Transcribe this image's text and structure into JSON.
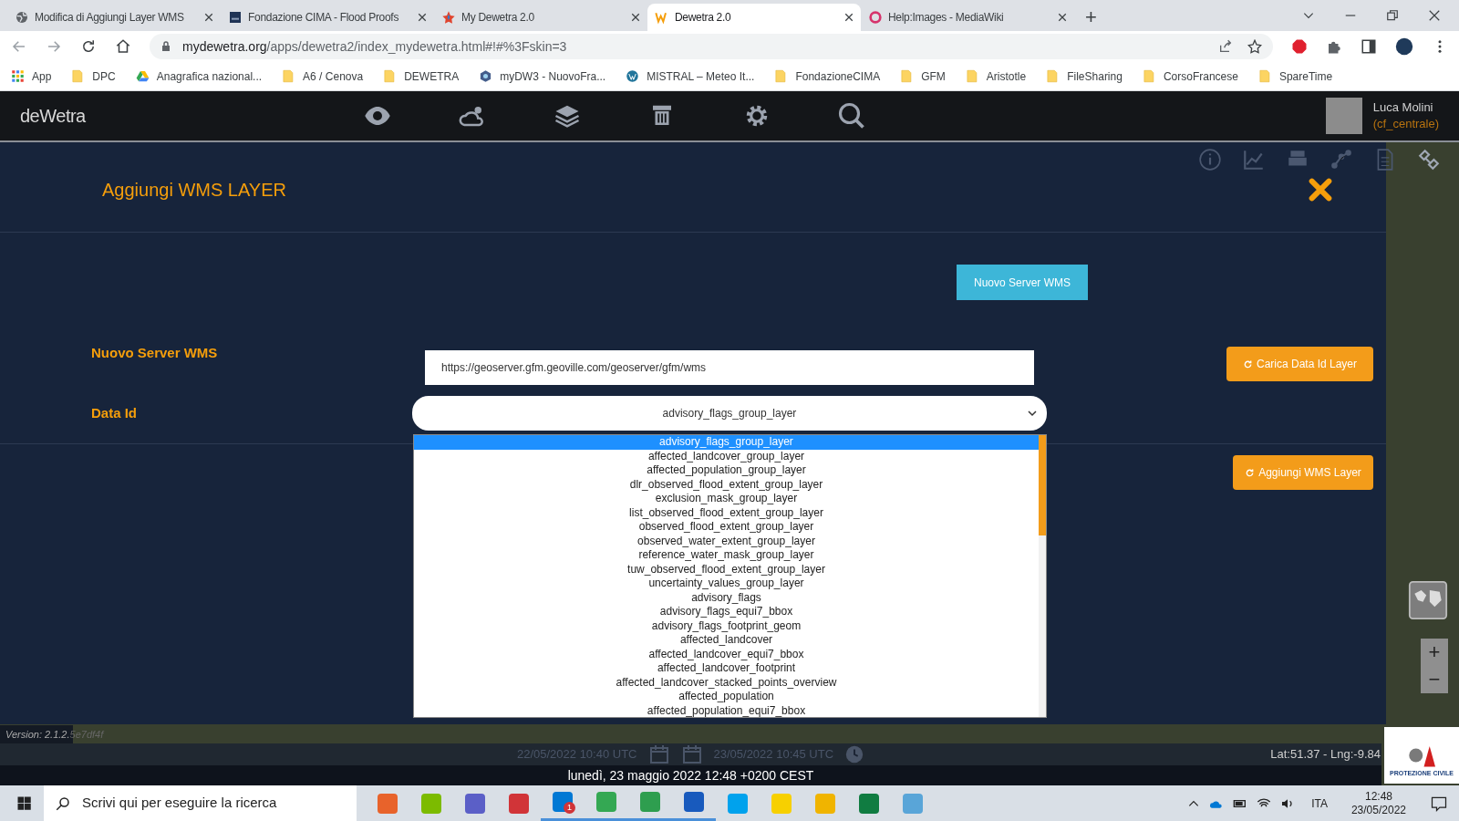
{
  "browser": {
    "tabs": [
      {
        "title": "Modifica di Aggiungi Layer WMS",
        "selected": false
      },
      {
        "title": "Fondazione CIMA - Flood Proofs",
        "selected": false
      },
      {
        "title": "My Dewetra 2.0",
        "selected": false
      },
      {
        "title": "Dewetra 2.0",
        "selected": true
      },
      {
        "title": "Help:Images - MediaWiki",
        "selected": false
      }
    ],
    "new_tab": "+",
    "url_host": "mydewetra.org",
    "url_path": "/apps/dewetra2/index_mydewetra.html#!#%3Fskin=3",
    "bookmarks": [
      {
        "label": "App",
        "kind": "apps"
      },
      {
        "label": "DPC",
        "kind": "folder"
      },
      {
        "label": "Anagrafica nazional...",
        "kind": "drive"
      },
      {
        "label": "A6 / Cenova",
        "kind": "folder"
      },
      {
        "label": "DEWETRA",
        "kind": "folder"
      },
      {
        "label": "myDW3 - NuovoFra...",
        "kind": "site"
      },
      {
        "label": "MISTRAL – Meteo It...",
        "kind": "wp"
      },
      {
        "label": "FondazioneCIMA",
        "kind": "folder"
      },
      {
        "label": "GFM",
        "kind": "folder"
      },
      {
        "label": "Aristotle",
        "kind": "folder"
      },
      {
        "label": "FileSharing",
        "kind": "folder"
      },
      {
        "label": "CorsoFrancese",
        "kind": "folder"
      },
      {
        "label": "SpareTime",
        "kind": "folder"
      }
    ]
  },
  "app": {
    "logo": "deWetra",
    "user": {
      "name": "Luca Molini",
      "role": "(cf_centrale)"
    }
  },
  "dialog": {
    "title": "Aggiungi WMS LAYER",
    "new_server_button": "Nuovo Server WMS",
    "server_label": "Nuovo Server WMS",
    "server_value": "https://geoserver.gfm.geoville.com/geoserver/gfm/wms",
    "data_id_label": "Data Id",
    "data_id_value": "advisory_flags_group_layer",
    "options": [
      {
        "label": "advisory_flags_group_layer",
        "selected": true
      },
      {
        "label": "affected_landcover_group_layer",
        "selected": false
      },
      {
        "label": "affected_population_group_layer",
        "selected": false
      },
      {
        "label": "dlr_observed_flood_extent_group_layer",
        "selected": false
      },
      {
        "label": "exclusion_mask_group_layer",
        "selected": false
      },
      {
        "label": "list_observed_flood_extent_group_layer",
        "selected": false
      },
      {
        "label": "observed_flood_extent_group_layer",
        "selected": false
      },
      {
        "label": "observed_water_extent_group_layer",
        "selected": false
      },
      {
        "label": "reference_water_mask_group_layer",
        "selected": false
      },
      {
        "label": "tuw_observed_flood_extent_group_layer",
        "selected": false
      },
      {
        "label": "uncertainty_values_group_layer",
        "selected": false
      },
      {
        "label": "advisory_flags",
        "selected": false
      },
      {
        "label": "advisory_flags_equi7_bbox",
        "selected": false
      },
      {
        "label": "advisory_flags_footprint_geom",
        "selected": false
      },
      {
        "label": "affected_landcover",
        "selected": false
      },
      {
        "label": "affected_landcover_equi7_bbox",
        "selected": false
      },
      {
        "label": "affected_landcover_footprint",
        "selected": false
      },
      {
        "label": "affected_landcover_stacked_points_overview",
        "selected": false
      },
      {
        "label": "affected_population",
        "selected": false
      },
      {
        "label": "affected_population_equi7_bbox",
        "selected": false
      }
    ],
    "load_button": "Carica Data Id Layer",
    "add_button": "Aggiungi WMS Layer"
  },
  "map": {
    "zoom_in": "+",
    "zoom_out": "−"
  },
  "footer": {
    "version": "Version: 2.1.2.",
    "version_hash": "5e7df4f",
    "from": "22/05/2022 10:40 UTC",
    "to": "23/05/2022 10:45 UTC",
    "coords": "Lat:51.37 - Lng:-9.84",
    "datetime": "lunedì, 23 maggio 2022 12:48 +0200 CEST",
    "logo_text": "PROTEZIONE CIVILE"
  },
  "taskbar": {
    "search_placeholder": "Scrivi qui per eseguire la ricerca",
    "apps": [
      {
        "color": "#e8632b",
        "active": false
      },
      {
        "color": "#7cbb00",
        "active": false
      },
      {
        "color": "#5b5fc7",
        "active": false
      },
      {
        "color": "#d13438",
        "active": false
      },
      {
        "color": "#0078d4",
        "active": true,
        "badge": "1"
      },
      {
        "color": "#34a853",
        "active": true
      },
      {
        "color": "#2e9e4f",
        "active": true
      },
      {
        "color": "#185abd",
        "active": true
      },
      {
        "color": "#00a2ed",
        "active": false
      },
      {
        "color": "#f7d000",
        "active": false
      },
      {
        "color": "#f0b400",
        "active": false
      },
      {
        "color": "#107c41",
        "active": false
      },
      {
        "color": "#59a5d8",
        "active": false
      }
    ],
    "language": "ITA",
    "time": "12:48",
    "date": "23/05/2022"
  }
}
